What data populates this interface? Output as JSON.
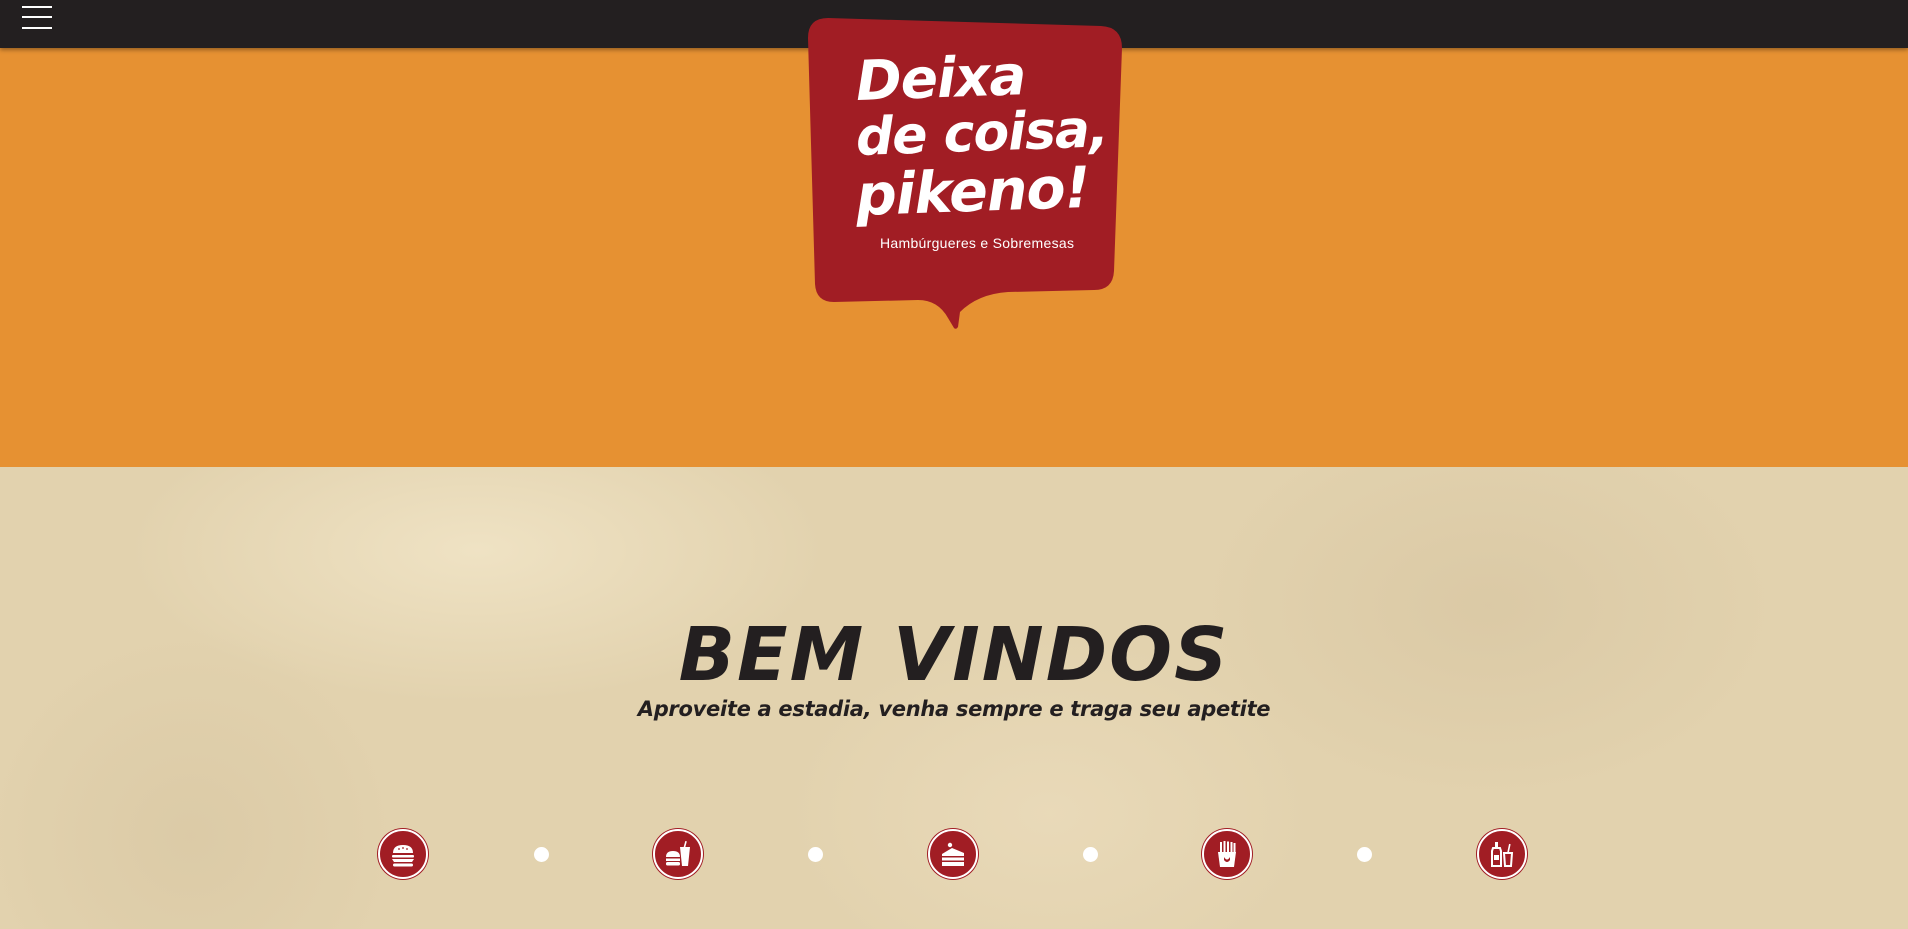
{
  "nav": {
    "menu_icon": "hamburger-menu-icon"
  },
  "logo": {
    "line1": "Deixa",
    "line2": "de coisa,",
    "line3": "pikeno!",
    "tagline": "Hambúrgueres e Sobremesas",
    "bubble_color": "#a11d24"
  },
  "colors": {
    "topbar": "#231f20",
    "hero": "#e69132",
    "accent": "#a11d24",
    "text": "#231f20"
  },
  "welcome": {
    "title": "BEM VINDOS",
    "subtitle": "Aproveite a estadia, venha sempre e traga seu apetite"
  },
  "categories": [
    {
      "icon": "burger-icon"
    },
    {
      "icon": "burger-and-drink-icon"
    },
    {
      "icon": "cake-icon"
    },
    {
      "icon": "fries-icon"
    },
    {
      "icon": "bottles-icon"
    }
  ]
}
